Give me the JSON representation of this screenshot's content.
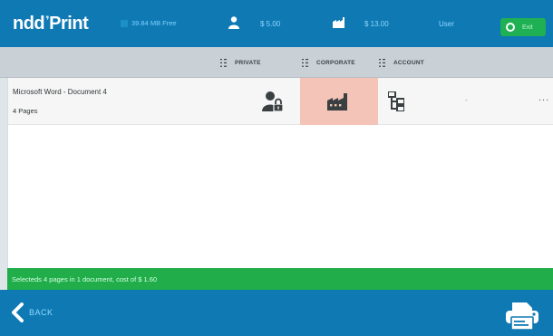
{
  "header": {
    "logo_main": "ndd",
    "logo_mark": "Print",
    "free_space": "39.84 MB Free",
    "private_balance": "$ 5.00",
    "corporate_balance": "$ 13.00",
    "user_label": "User",
    "exit_label": "Exit"
  },
  "columns": {
    "private": "PRIVATE",
    "corporate": "CORPORATE",
    "account": "ACCOUNT"
  },
  "documents": [
    {
      "name": "Microsoft Word - Document 4",
      "pages": "4 Pages",
      "account_value": "-",
      "more": "..."
    }
  ],
  "status": {
    "text": "Selecteds 4 pages in 1 document, cost of $ 1.60"
  },
  "footer": {
    "back_label": "BACK"
  },
  "colors": {
    "bar_blue": "#0f79b4",
    "status_green": "#20ad4a",
    "selected_corporate": "#f3c4b7"
  },
  "icons": {
    "private_balance": "user-icon",
    "corporate_balance": "factory-icon",
    "exit": "power-icon",
    "private_column": "user-lock-icon",
    "corporate_column": "factory-icon",
    "account_column": "account-tree-icon",
    "back": "chevron-left-icon",
    "print": "printer-icon"
  }
}
